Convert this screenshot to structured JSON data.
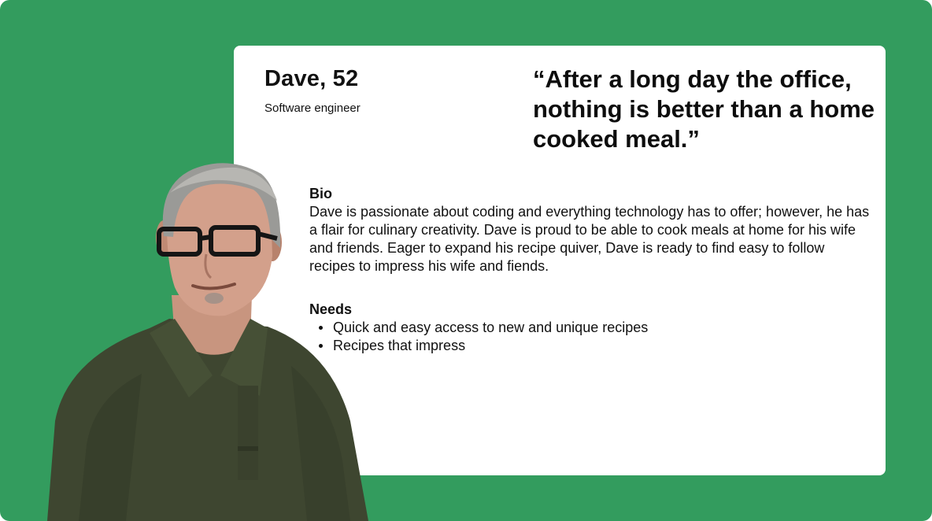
{
  "persona": {
    "name": "Dave, 52",
    "role": "Software engineer",
    "quote": "“After a long day the office, nothing is better than a home cooked meal.”"
  },
  "bio": {
    "title": "Bio",
    "text": "Dave is passionate about coding and everything technology has to offer; however, he has a flair for culinary creativity. Dave is proud to be able to cook meals at home for his wife and friends. Eager to expand his recipe quiver, Dave is ready to find easy to follow recipes to impress his wife and fiends."
  },
  "needs": {
    "title": "Needs",
    "items": [
      "Quick and easy access to new and unique recipes",
      "Recipes that impress"
    ]
  },
  "colors": {
    "background": "#339c5e",
    "card": "#ffffff",
    "shirt": "#3e4630",
    "text": "#111111"
  }
}
